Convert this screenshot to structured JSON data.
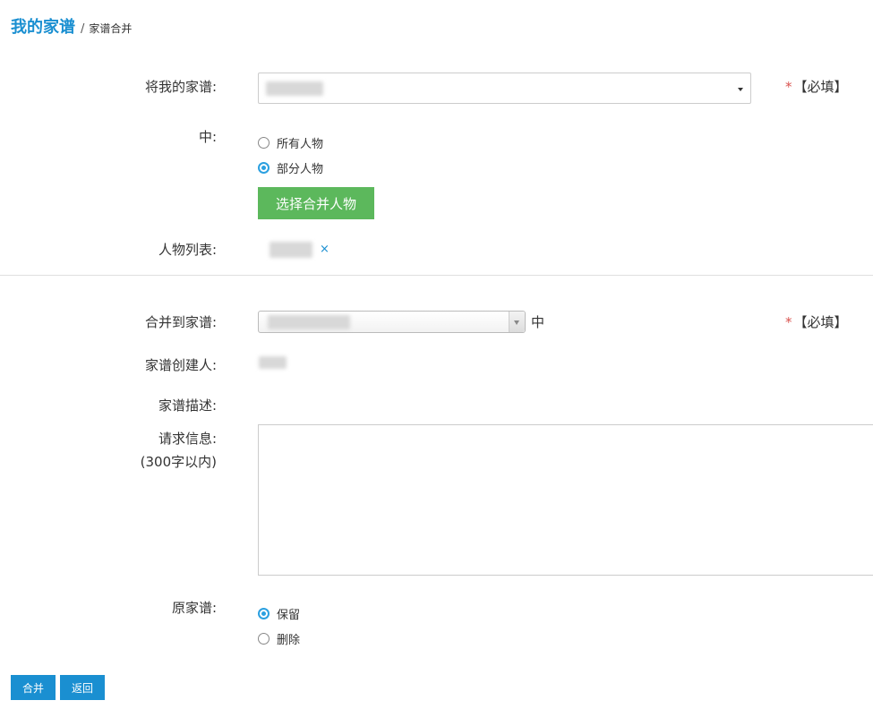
{
  "breadcrumb": {
    "main": "我的家谱",
    "separator": "/",
    "current": "家谱合并"
  },
  "form": {
    "my_tree_label": "将我的家谱:",
    "required_star": "*",
    "required_text": "【必填】",
    "in_label": "中:",
    "scope_options": [
      {
        "label": "所有人物",
        "checked": false
      },
      {
        "label": "部分人物",
        "checked": true
      }
    ],
    "select_people_button": "选择合并人物",
    "people_list_label": "人物列表:",
    "remove_symbol": "×",
    "merge_to_label": "合并到家谱:",
    "merge_to_suffix": "中",
    "creator_label": "家谱创建人:",
    "description_label": "家谱描述:",
    "request_label": "请求信息:",
    "request_hint": "(300字以内)",
    "original_label": "原家谱:",
    "original_options": [
      {
        "label": "保留",
        "checked": true
      },
      {
        "label": "删除",
        "checked": false
      }
    ]
  },
  "actions": {
    "merge_button": "合并",
    "back_button": "返回"
  },
  "colors": {
    "accent": "#1a8fd1",
    "green": "#5cb85c",
    "required": "#d9534f"
  }
}
